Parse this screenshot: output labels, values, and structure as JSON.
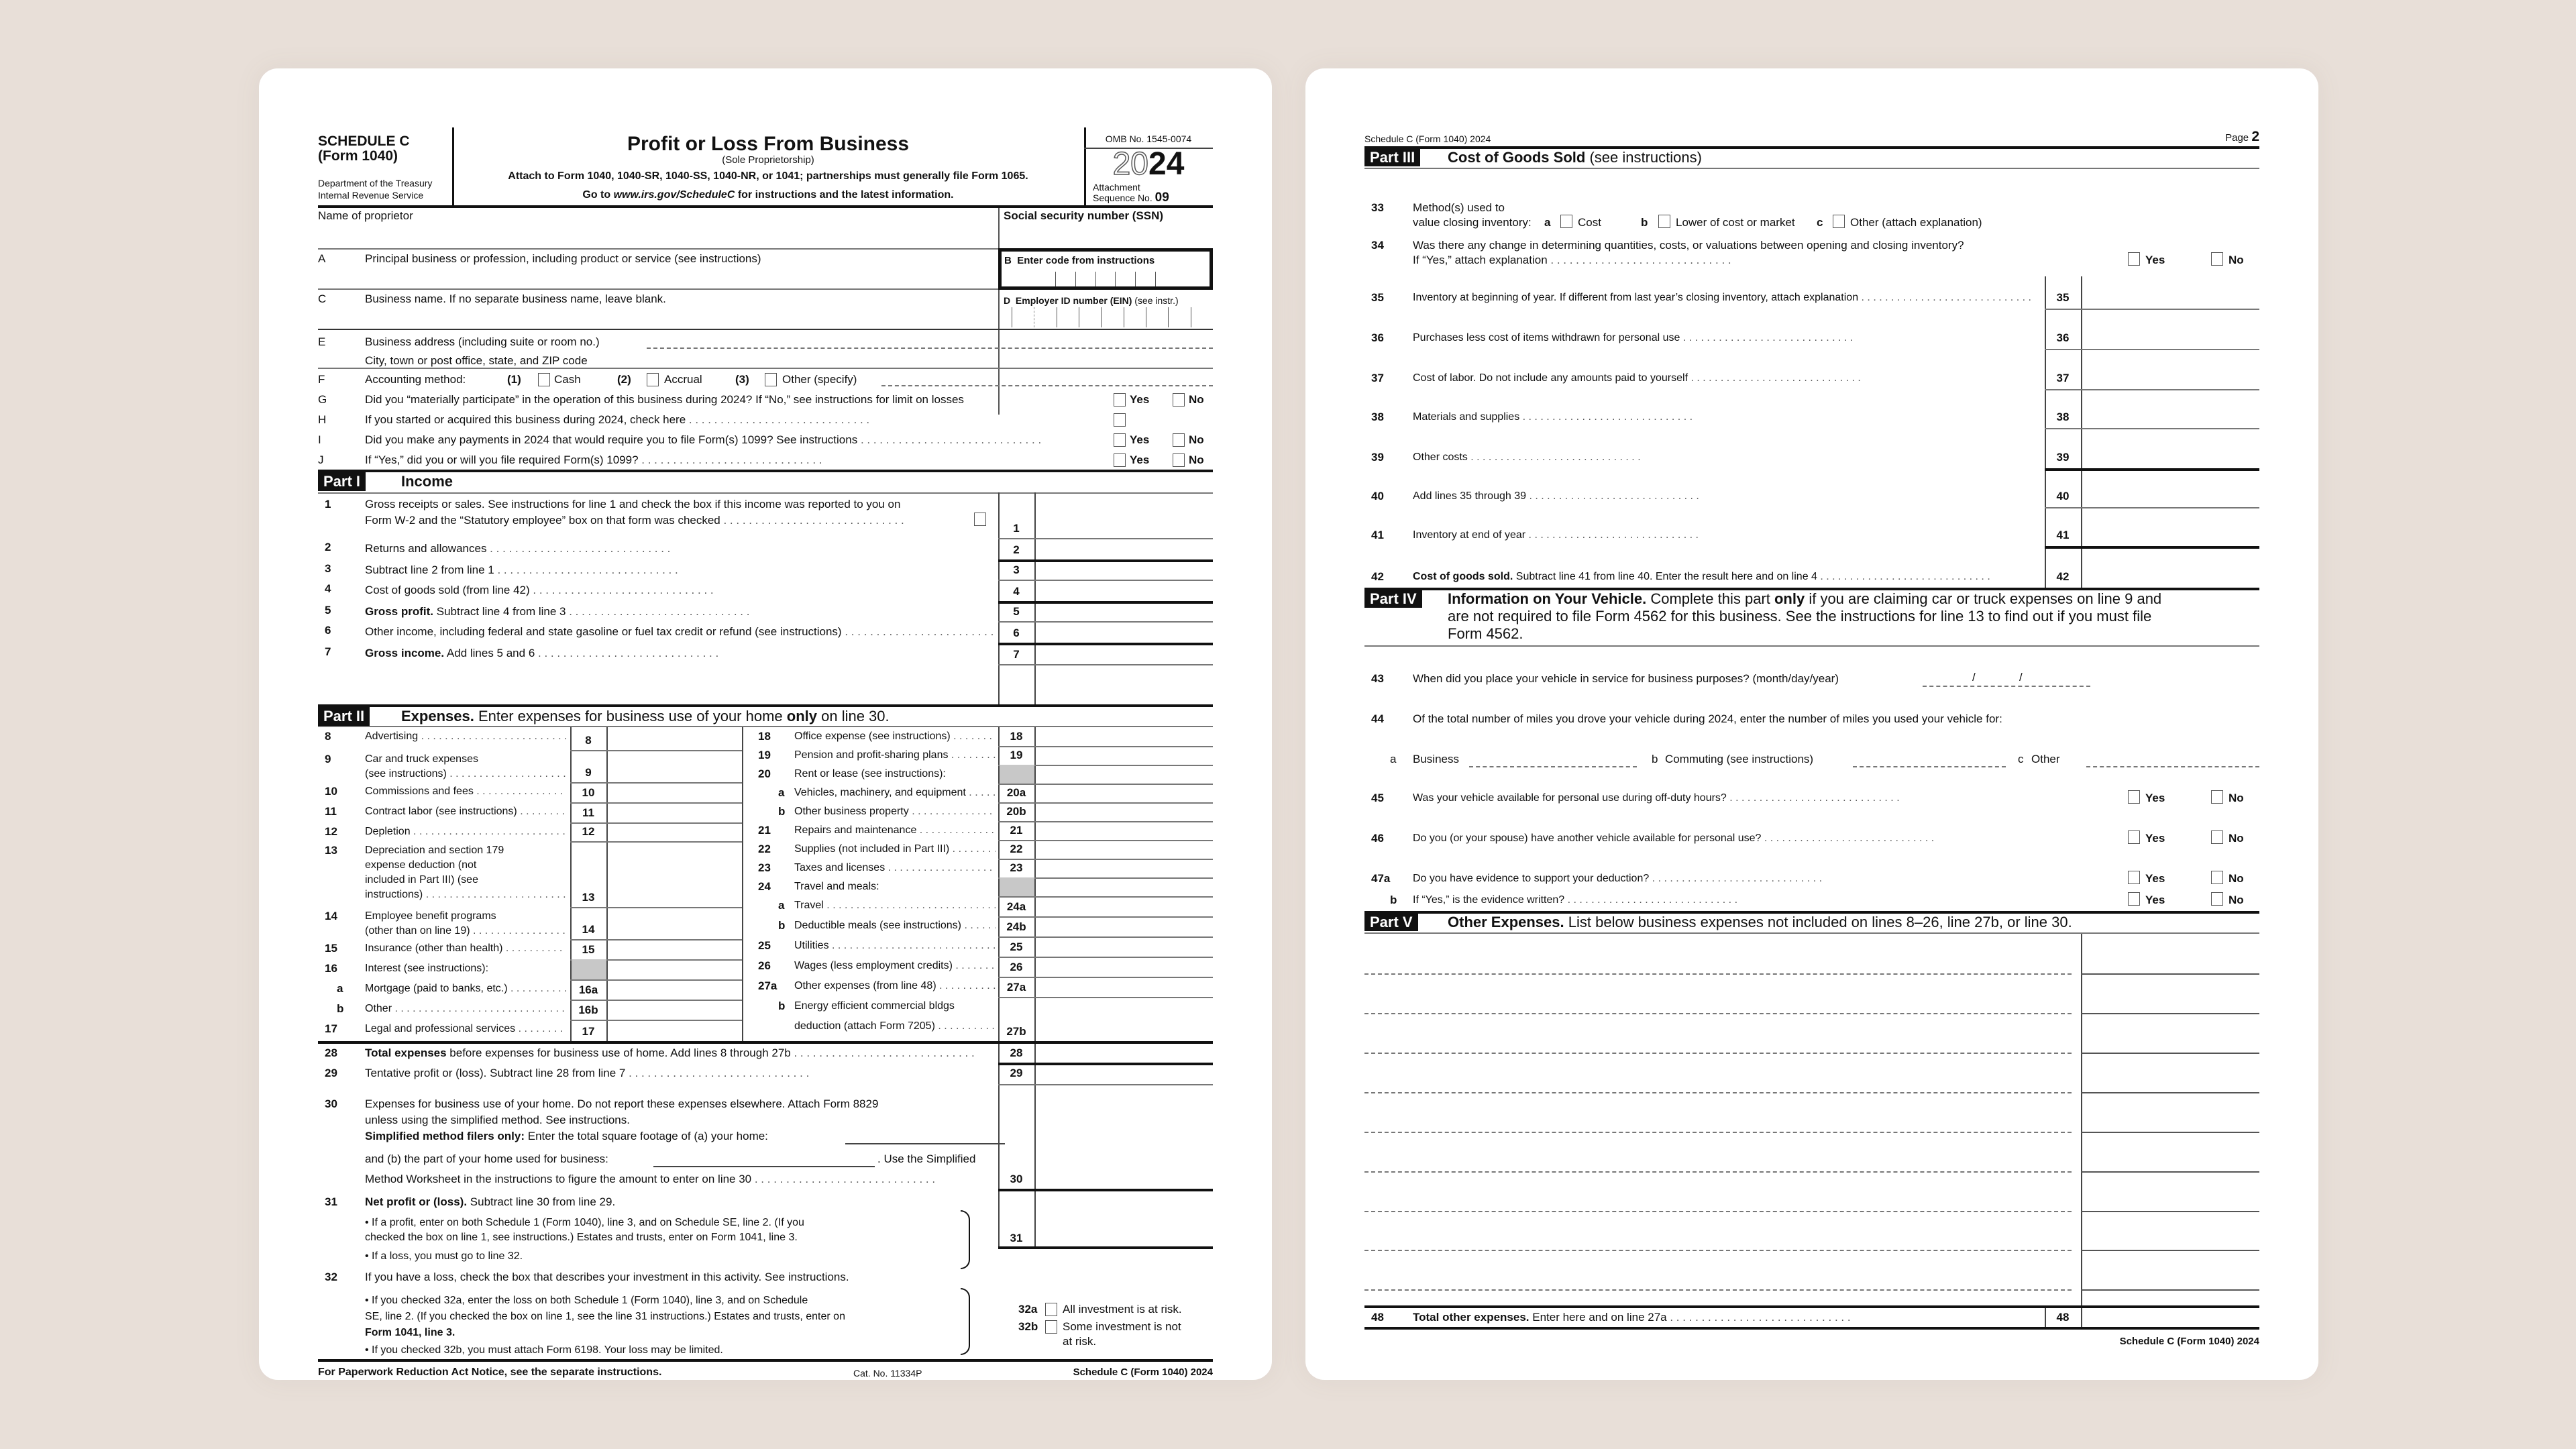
{
  "page1": {
    "form_id": "SCHEDULE C",
    "form_sub": "(Form 1040)",
    "dept": "Department of the Treasury",
    "irs": "Internal Revenue Service",
    "title": "Profit or Loss From Business",
    "subtitle": "(Sole Proprietorship)",
    "attach": "Attach to Form 1040, 1040-SR, 1040-SS, 1040-NR, or 1041; partnerships must generally file Form 1065.",
    "goto_pre": "Go to ",
    "goto_url": "www.irs.gov/ScheduleC",
    "goto_post": " for instructions and the latest information.",
    "omb": "OMB No. 1545-0074",
    "year_outline": "20",
    "year_bold": "24",
    "attachment": "Attachment",
    "sequence": "Sequence No.",
    "sequence_no": "09",
    "name_label": "Name of proprietor",
    "ssn_label": "Social security number (SSN)",
    "A": {
      "letter": "A",
      "text": "Principal business or profession, including product or service (see instructions)"
    },
    "B": {
      "letter": "B",
      "text": "Enter code from instructions"
    },
    "C": {
      "letter": "C",
      "text": "Business name. If no separate business name, leave blank."
    },
    "D": {
      "letter": "D",
      "text": "Employer ID number (EIN)",
      "note": "(see instr.)"
    },
    "E": {
      "letter": "E",
      "text": "Business address (including suite or room no.)",
      "city": "City, town or post office, state, and ZIP code"
    },
    "F": {
      "letter": "F",
      "text": "Accounting method:",
      "opts": [
        {
          "n": "(1)",
          "label": "Cash"
        },
        {
          "n": "(2)",
          "label": "Accrual"
        },
        {
          "n": "(3)",
          "label": "Other (specify)"
        }
      ]
    },
    "G": {
      "letter": "G",
      "text": "Did you “materially participate” in the operation of this business during 2024? If “No,” see instructions for limit on losses"
    },
    "H": {
      "letter": "H",
      "text": "If you started or acquired this business during 2024, check here"
    },
    "I": {
      "letter": "I",
      "text": "Did you make any payments in 2024 that would require you to file Form(s) 1099? See instructions"
    },
    "J": {
      "letter": "J",
      "text": "If “Yes,” did you or will you file required Form(s) 1099?"
    },
    "yes": "Yes",
    "no": "No",
    "part1": {
      "label": "Part I",
      "title": "Income"
    },
    "income": [
      {
        "n": "1",
        "text": "Gross receipts or sales. See instructions for line 1 and check the box if this income was reported to you on",
        "text2": "Form W-2 and the “Statutory employee” box on that form was checked"
      },
      {
        "n": "2",
        "text": "Returns and allowances"
      },
      {
        "n": "3",
        "text": "Subtract line 2 from line 1"
      },
      {
        "n": "4",
        "text": "Cost of goods sold (from line 42)"
      },
      {
        "n": "5",
        "bold": "Gross profit.",
        "text": " Subtract line 4 from line 3"
      },
      {
        "n": "6",
        "text": "Other income, including federal and state gasoline or fuel tax credit or refund (see instructions)"
      },
      {
        "n": "7",
        "bold": "Gross income.",
        "text": " Add lines 5 and 6"
      }
    ],
    "part2": {
      "label": "Part II",
      "title": "Expenses.",
      "desc_pre": " Enter expenses for business use of your home ",
      "desc_bold": "only",
      "desc_post": " on line 30."
    },
    "exp_left": [
      {
        "n": "8",
        "text": "Advertising",
        "box": "8"
      },
      {
        "n": "9",
        "text": "Car and truck expenses",
        "text2": "(see instructions)",
        "box": "9"
      },
      {
        "n": "10",
        "text": "Commissions and fees",
        "box": "10"
      },
      {
        "n": "11",
        "text": "Contract labor (see instructions)",
        "box": "11"
      },
      {
        "n": "12",
        "text": "Depletion",
        "box": "12"
      },
      {
        "n": "13",
        "text": "Depreciation and section 179",
        "text2": "expense deduction (not",
        "text3": "included in Part III) (see",
        "text4": "instructions)",
        "box": "13"
      },
      {
        "n": "14",
        "text": "Employee benefit programs",
        "text2": "(other than on line 19)",
        "box": "14"
      },
      {
        "n": "15",
        "text": "Insurance (other than health)",
        "box": "15"
      },
      {
        "n": "16",
        "text": "Interest (see instructions):",
        "box": ""
      },
      {
        "n": "a",
        "text": "Mortgage (paid to banks, etc.)",
        "box": "16a"
      },
      {
        "n": "b",
        "text": "Other",
        "box": "16b"
      },
      {
        "n": "17",
        "text": "Legal and professional services",
        "box": "17"
      }
    ],
    "exp_right": [
      {
        "n": "18",
        "text": "Office expense (see instructions)",
        "box": "18"
      },
      {
        "n": "19",
        "text": "Pension and profit-sharing plans",
        "box": "19"
      },
      {
        "n": "20",
        "text": "Rent or lease (see instructions):",
        "box": ""
      },
      {
        "n": "a",
        "text": "Vehicles, machinery, and equipment",
        "box": "20a"
      },
      {
        "n": "b",
        "text": "Other business property",
        "box": "20b"
      },
      {
        "n": "21",
        "text": "Repairs and maintenance",
        "box": "21"
      },
      {
        "n": "22",
        "text": "Supplies (not included in Part III)",
        "box": "22"
      },
      {
        "n": "23",
        "text": "Taxes and licenses",
        "box": "23"
      },
      {
        "n": "24",
        "text": "Travel and meals:",
        "box": ""
      },
      {
        "n": "a",
        "text": "Travel",
        "box": "24a"
      },
      {
        "n": "b",
        "text": "Deductible meals (see instructions)",
        "box": "24b"
      },
      {
        "n": "25",
        "text": "Utilities",
        "box": "25"
      },
      {
        "n": "26",
        "text": "Wages (less employment credits)",
        "box": "26"
      },
      {
        "n": "27a",
        "text": "Other expenses (from line 48)",
        "box": "27a"
      },
      {
        "n": "b",
        "text": "Energy efficient commercial bldgs",
        "text2": "deduction (attach Form 7205)",
        "box": "27b"
      }
    ],
    "l28": {
      "n": "28",
      "bold": "Total expenses",
      "text": " before expenses for business use of home. Add lines 8 through 27b"
    },
    "l29": {
      "n": "29",
      "text": "Tentative profit or (loss). Subtract line 28 from line 7"
    },
    "l30": {
      "n": "30",
      "text": "Expenses for business use of your home. Do not report these expenses elsewhere. Attach Form 8829",
      "text2": "unless using the simplified method. See instructions.",
      "bold3": "Simplified method filers only:",
      "text3": " Enter the total square footage of (a) your home:",
      "text4": "and (b) the part of your home used for business:",
      "text4b": ". Use the Simplified",
      "text5": "Method Worksheet in the instructions to figure the amount to enter on line 30"
    },
    "l31": {
      "n": "31",
      "bold": "Net profit or (loss).",
      "text": " Subtract line 30 from line 29.",
      "b1": "• If a profit, enter on both Schedule 1 (Form 1040), line 3, and on Schedule SE, line 2. (If you",
      "b1b": "checked the box on line 1, see instructions.) Estates and trusts, enter on Form 1041, line 3.",
      "b2": "• If a loss, you must  go to line 32."
    },
    "l32": {
      "n": "32",
      "text": "If you have a loss, check the box that describes your investment in this activity. See instructions.",
      "b1": "• If you checked 32a, enter the loss on both Schedule 1 (Form 1040), line 3, and on Schedule",
      "b1b": "SE, line 2. (If you checked the box on line 1, see the line 31 instructions.) Estates and trusts, enter on",
      "b1c": "Form 1041, line 3.",
      "b2": "• If you checked 32b, you must attach Form 6198. Your loss may be limited.",
      "a_n": "32a",
      "a_text": "All investment is at risk.",
      "b_n": "32b",
      "b_text": "Some investment is not",
      "b_text2": "at risk."
    },
    "footer_left": "For Paperwork Reduction Act Notice, see the separate instructions.",
    "footer_cat": "Cat. No. 11334P",
    "footer_right": "Schedule C (Form 1040) 2024"
  },
  "page2": {
    "header_left": "Schedule C (Form 1040) 2024",
    "page_label": "Page",
    "page_no": "2",
    "part3": {
      "label": "Part III",
      "title": "Cost of Goods Sold",
      "desc": " (see instructions)"
    },
    "l33": {
      "n": "33",
      "text": "Method(s) used to",
      "text2": "value closing inventory:",
      "opts": [
        {
          "l": "a",
          "label": "Cost"
        },
        {
          "l": "b",
          "label": "Lower of cost or market"
        },
        {
          "l": "c",
          "label": "Other (attach explanation)"
        }
      ]
    },
    "l34": {
      "n": "34",
      "text": "Was there any change in determining quantities, costs, or valuations between opening and closing inventory?",
      "text2": "If “Yes,” attach explanation"
    },
    "cogs": [
      {
        "n": "35",
        "text": "Inventory at beginning of year. If different from last year’s closing inventory, attach explanation"
      },
      {
        "n": "36",
        "text": "Purchases less cost of items withdrawn for personal use"
      },
      {
        "n": "37",
        "text": "Cost of labor. Do not include any amounts paid to yourself"
      },
      {
        "n": "38",
        "text": "Materials and supplies"
      },
      {
        "n": "39",
        "text": "Other costs"
      },
      {
        "n": "40",
        "text": "Add lines 35 through 39"
      },
      {
        "n": "41",
        "text": "Inventory at end of year"
      },
      {
        "n": "42",
        "bold": "Cost of goods sold.",
        "text": " Subtract line 41 from line 40. Enter the result here and on line 4"
      }
    ],
    "part4": {
      "label": "Part IV",
      "title": "Information on Your Vehicle.",
      "desc_pre": " Complete this part ",
      "desc_bold": "only",
      "desc_post": " if you are claiming car or truck expenses on line 9 and",
      "desc2": "are not required to file Form 4562 for this business. See the instructions for line 13 to find out if you must file",
      "desc3": "Form 4562."
    },
    "l43": {
      "n": "43",
      "text": "When did you place your vehicle in service for business purposes? (month/day/year)",
      "sep": "/"
    },
    "l44": {
      "n": "44",
      "text": "Of the total number of miles you drove your vehicle during 2024, enter the number of miles you used your vehicle for:",
      "a": "a",
      "a_label": "Business",
      "b": "b",
      "b_label": "Commuting (see instructions)",
      "c": "c",
      "c_label": "Other"
    },
    "yesno": [
      {
        "n": "45",
        "text": "Was your vehicle available for personal use during off-duty hours?"
      },
      {
        "n": "46",
        "text": "Do you (or your spouse) have another vehicle available for personal use?"
      },
      {
        "n": "47a",
        "text": "Do you have evidence to support your deduction?"
      },
      {
        "n": "b",
        "text": "If “Yes,” is the evidence written?"
      }
    ],
    "yes": "Yes",
    "no": "No",
    "part5": {
      "label": "Part V",
      "title": "Other Expenses.",
      "desc": " List below business expenses not included on lines 8–26, line 27b, or line 30."
    },
    "other_rows": 9,
    "l48": {
      "n": "48",
      "bold": "Total other expenses.",
      "text": " Enter here and on line 27a"
    },
    "footer_right": "Schedule C (Form 1040) 2024"
  }
}
